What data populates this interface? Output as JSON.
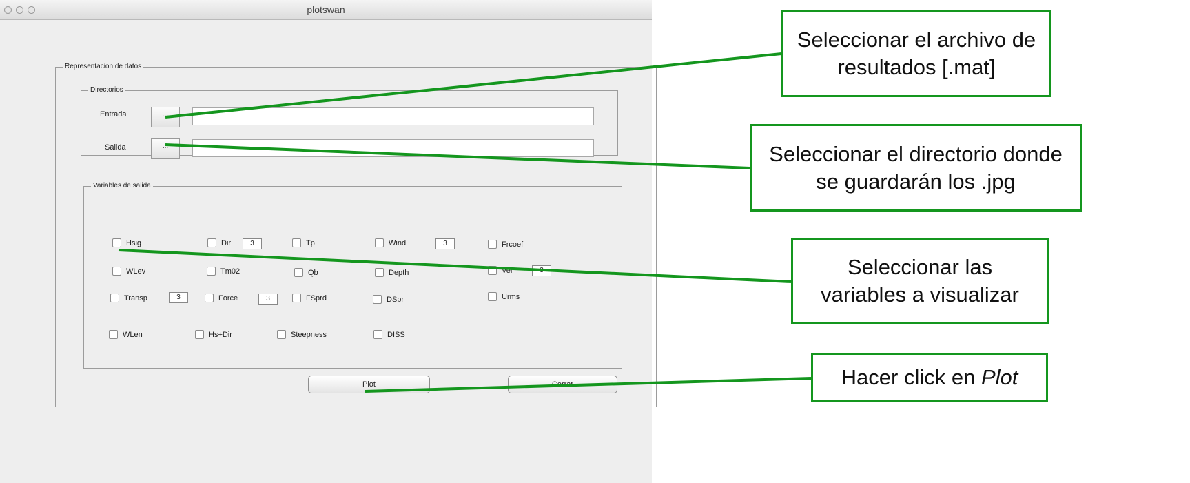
{
  "window": {
    "title": "plotswan"
  },
  "panel_main": {
    "legend": "Representacion de datos"
  },
  "directorios": {
    "legend": "Directorios",
    "entrada_label": "Entrada",
    "salida_label": "Salida",
    "browse_label": "...",
    "entrada_value": "",
    "salida_value": ""
  },
  "variables": {
    "legend": "Variables de salida",
    "rows": [
      [
        {
          "label": "Hsig"
        },
        {
          "label": "Dir",
          "num": "3"
        },
        {
          "label": "Tp"
        },
        {
          "label": "Wind",
          "num": "3"
        },
        {
          "label": "Frcoef"
        }
      ],
      [
        {
          "label": "WLev"
        },
        {
          "label": "Tm02"
        },
        {
          "label": "Qb"
        },
        {
          "label": "Depth"
        },
        {
          "label": "Vel",
          "num": "3"
        }
      ],
      [
        {
          "label": "Transp",
          "num": "3"
        },
        {
          "label": "Force",
          "num": "3"
        },
        {
          "label": "FSprd"
        },
        {
          "label": "DSpr"
        },
        {
          "label": "Urms"
        }
      ],
      [
        {
          "label": "WLen"
        },
        {
          "label": "Hs+Dir"
        },
        {
          "label": "Steepness"
        },
        {
          "label": "DISS"
        }
      ]
    ]
  },
  "buttons": {
    "plot": "Plot",
    "cerrar": "Cerrar"
  },
  "callouts": {
    "archivo": "Seleccionar el archivo de resultados [.mat]",
    "directorio": "Seleccionar el directorio donde se guardarán los .jpg",
    "variables": "Seleccionar las variables a visualizar",
    "plot_prefix": "Hacer click en ",
    "plot_word": "Plot"
  },
  "colors": {
    "callout_border": "#14961e",
    "window_bg": "#eeeeee"
  }
}
